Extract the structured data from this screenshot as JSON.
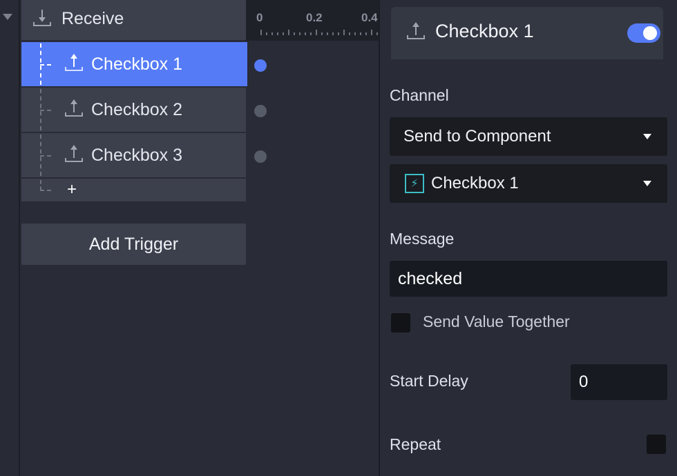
{
  "tree": {
    "receive": {
      "label": "Receive",
      "icon": "download-icon"
    },
    "items": [
      {
        "label": "Checkbox 1",
        "icon": "upload-icon",
        "selected": true
      },
      {
        "label": "Checkbox 2",
        "icon": "upload-icon",
        "selected": false
      },
      {
        "label": "Checkbox 3",
        "icon": "upload-icon",
        "selected": false
      }
    ],
    "add_symbol": "+",
    "add_trigger_label": "Add Trigger"
  },
  "timeline": {
    "ruler_labels": [
      "0",
      "0.2",
      "0.4"
    ]
  },
  "inspector": {
    "title": "Checkbox 1",
    "enabled": true,
    "channel_label": "Channel",
    "channel_value": "Send to Component",
    "component_value": "Checkbox 1",
    "component_icon_glyph": "⚡",
    "message_label": "Message",
    "message_value": "checked",
    "send_value_label": "Send Value Together",
    "send_value_checked": false,
    "start_delay_label": "Start Delay",
    "start_delay_value": "0",
    "repeat_label": "Repeat",
    "repeat_checked": false
  },
  "colors": {
    "accent": "#567bf7",
    "component_icon": "#3dbdc4"
  }
}
